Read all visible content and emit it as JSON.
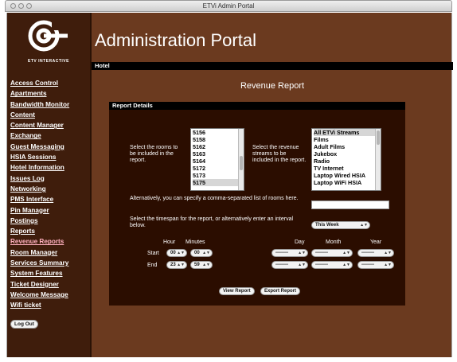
{
  "window": {
    "title": "ETVi Admin Portal"
  },
  "sidebar": {
    "logo_text": "ETV INTERACTIVE",
    "items": [
      {
        "label": "Access Control"
      },
      {
        "label": "Apartments"
      },
      {
        "label": "Bandwidth Monitor"
      },
      {
        "label": "Content"
      },
      {
        "label": "Content Manager"
      },
      {
        "label": "Exchange"
      },
      {
        "label": "Guest Messaging"
      },
      {
        "label": "HSIA Sessions"
      },
      {
        "label": "Hotel Information"
      },
      {
        "label": "Issues Log"
      },
      {
        "label": "Networking"
      },
      {
        "label": "PMS Interface"
      },
      {
        "label": "Pin Manager"
      },
      {
        "label": "Postings"
      },
      {
        "label": "Reports"
      },
      {
        "label": "Revenue Reports"
      },
      {
        "label": "Room Manager"
      },
      {
        "label": "Services Summary"
      },
      {
        "label": "System Features"
      },
      {
        "label": "Ticket Designer"
      },
      {
        "label": "Welcome Message"
      },
      {
        "label": "Wifi ticket"
      }
    ],
    "active_item": "Revenue Reports",
    "logout_label": "Log Out"
  },
  "header": {
    "title": "Administration Portal",
    "tab": "Hotel"
  },
  "main": {
    "heading": "Revenue Report",
    "panel_title": "Report Details",
    "rooms_label": "Select the rooms to be included in the report.",
    "rooms": [
      "5156",
      "5158",
      "5162",
      "5163",
      "5164",
      "5172",
      "5173",
      "5175"
    ],
    "streams_label": "Select the revenue streams to be included in the report.",
    "streams": [
      "All ETVi Streams",
      "Films",
      "Adult Films",
      "Jukebox",
      "Radio",
      "TV Internet",
      "Laptop Wired HSIA",
      "Laptop WiFi HSIA"
    ],
    "alt_rooms_label": "Alternatively, you can specify a comma-separated list of rooms here.",
    "alt_rooms_value": "",
    "timespan_label": "Select the timespan for the report, or alternatively enter an interval below.",
    "timespan_value": "This Week",
    "col_hour": "Hour",
    "col_minutes": "Minutes",
    "col_day": "Day",
    "col_month": "Month",
    "col_year": "Year",
    "start_label": "Start",
    "end_label": "End",
    "start_hour": "00",
    "start_minutes": "00",
    "end_hour": "23",
    "end_minutes": "59",
    "date_placeholder": "--------",
    "view_button": "View Report",
    "export_button": "Export Report"
  },
  "colors": {
    "background": "#6b3a1f",
    "sidebar": "#3f1d0c",
    "panel": "#2b0d00",
    "active_link": "#ffb0bf"
  }
}
